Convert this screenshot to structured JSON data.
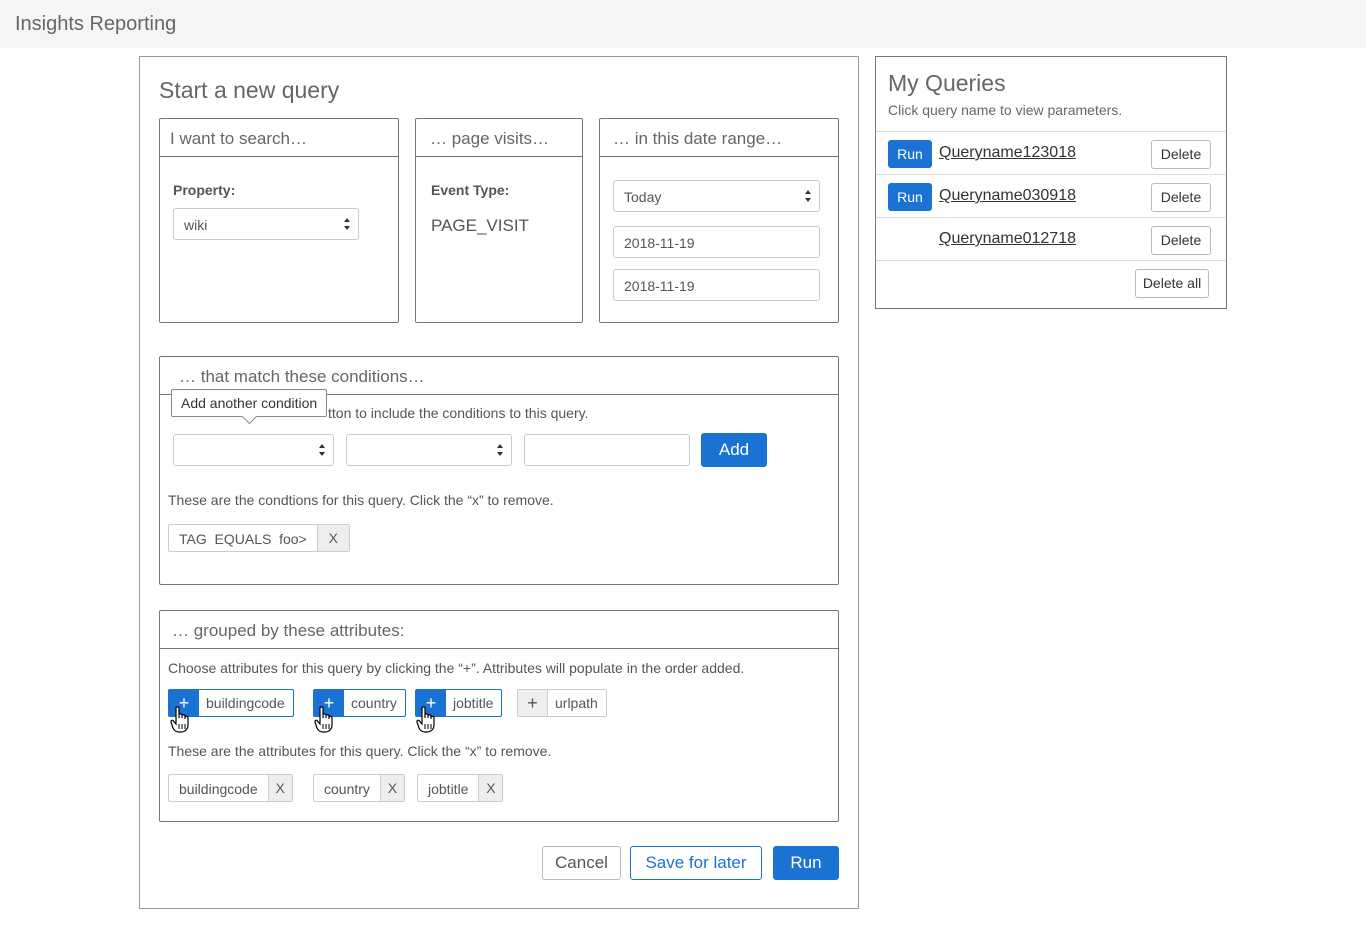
{
  "app": {
    "title": "Insights Reporting"
  },
  "query_form": {
    "title": "Start a new query",
    "search_box": {
      "heading": "I want to search…",
      "property_label": "Property:",
      "property_value": "wiki"
    },
    "visits_box": {
      "heading": "… page visits…",
      "event_type_label": "Event Type:",
      "event_type_value": "PAGE_VISIT"
    },
    "date_box": {
      "heading": "… in this date range…",
      "range_value": "Today",
      "start_date": "2018-11-19",
      "end_date": "2018-11-19"
    },
    "conditions": {
      "heading": "… that match these conditions…",
      "tooltip": "Add another condition",
      "help_visible": "tton to include the conditions to this query.",
      "add_label": "Add",
      "list_help": "These are the condtions for this query. Click the “x” to remove.",
      "items": [
        {
          "text": "TAG  EQUALS  foo>",
          "remove": "X"
        }
      ]
    },
    "attributes": {
      "heading": "… grouped by these attributes:",
      "help": "Choose attributes for this query by clicking the “+”. Attributes will populate in the order added.",
      "plus_symbol": "+",
      "available": [
        {
          "name": "buildingcode",
          "selected": true
        },
        {
          "name": "country",
          "selected": true
        },
        {
          "name": "jobtitle",
          "selected": true
        },
        {
          "name": "urlpath",
          "selected": false
        }
      ],
      "list_help": "These are the attributes for this query. Click the “x” to remove.",
      "selected": [
        {
          "name": "buildingcode",
          "remove": "X"
        },
        {
          "name": "country",
          "remove": "X"
        },
        {
          "name": "jobtitle",
          "remove": "X"
        }
      ]
    },
    "actions": {
      "cancel": "Cancel",
      "save": "Save for later",
      "run": "Run"
    }
  },
  "my_queries": {
    "title": "My Queries",
    "subtitle": "Click query name to view parameters.",
    "items": [
      {
        "name": "Queryname123018",
        "run": "Run",
        "delete": "Delete"
      },
      {
        "name": "Queryname030918",
        "run": "Run",
        "delete": "Delete"
      },
      {
        "name": "Queryname012718",
        "run": "",
        "delete": "Delete"
      }
    ],
    "delete_all": "Delete all"
  },
  "colors": {
    "primary": "#1a73d2",
    "border": "#777777"
  }
}
